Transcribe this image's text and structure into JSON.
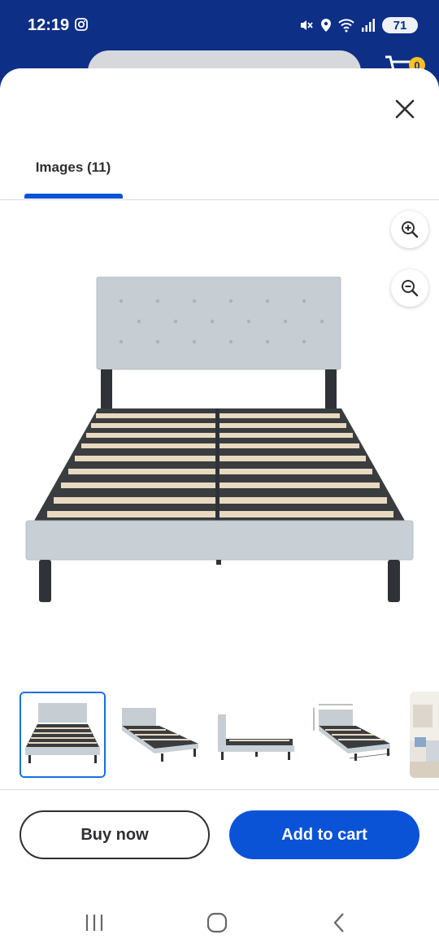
{
  "status_bar": {
    "time": "12:19",
    "battery": "71",
    "icons": [
      "instagram-icon",
      "mute-icon",
      "location-icon",
      "wifi-icon",
      "signal-icon",
      "battery-icon"
    ]
  },
  "header": {
    "cart_count": "0",
    "icons": [
      "search-icon",
      "scan-icon",
      "cart-icon"
    ]
  },
  "sheet": {
    "close_icon": "close-icon",
    "tabs": [
      {
        "label": "Images (11)",
        "selected": true
      }
    ],
    "zoom_in_icon": "zoom-in-icon",
    "zoom_out_icon": "zoom-out-icon",
    "thumbnails": [
      {
        "name": "thumbnail-front-view",
        "selected": true
      },
      {
        "name": "thumbnail-angle-view",
        "selected": false
      },
      {
        "name": "thumbnail-side-view",
        "selected": false
      },
      {
        "name": "thumbnail-dimensions",
        "selected": false
      },
      {
        "name": "thumbnail-room-scene",
        "selected": false
      }
    ]
  },
  "actions": {
    "buy_now": "Buy now",
    "add_to_cart": "Add to cart"
  },
  "nav": {
    "icons": [
      "recents-icon",
      "home-icon",
      "back-icon"
    ]
  },
  "colors": {
    "brand_blue": "#0d2f86",
    "action_blue": "#0a53d6",
    "badge_yellow": "#ffc220",
    "selected_border": "#1a6ee0"
  }
}
